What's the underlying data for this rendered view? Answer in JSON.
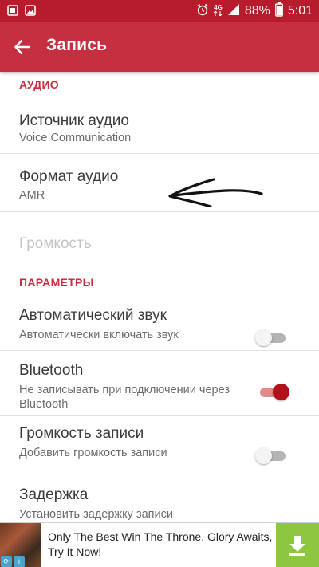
{
  "status_bar": {
    "network": "4G",
    "battery": "88%",
    "time": "5:01"
  },
  "app_bar": {
    "title": "Запись"
  },
  "sections": {
    "audio": {
      "header": "АУДИО",
      "source": {
        "title": "Источник аудио",
        "summary": "Voice Communication"
      },
      "format": {
        "title": "Формат аудио",
        "summary": "AMR"
      },
      "volume": {
        "title": "Громкость"
      }
    },
    "params": {
      "header": "ПАРАМЕТРЫ",
      "auto_sound": {
        "title": "Автоматический звук",
        "summary": "Автоматически включать звук",
        "checked": false
      },
      "bluetooth": {
        "title": "Bluetooth",
        "summary": "Не записывать при подключении через Bluetooth",
        "checked": true
      },
      "record_volume": {
        "title": "Громкость записи",
        "summary": "Добавить громкость записи",
        "checked": false
      },
      "delay": {
        "title": "Задержка",
        "summary": "Установить задержку записи"
      }
    }
  },
  "ad": {
    "text": "Only The Best Win The Throne. Glory Awaits, Try It Now!"
  },
  "colors": {
    "status_bar": "#b71c2c",
    "app_bar": "#c62f3f",
    "accent": "#c62f3f",
    "switch_on": "#b0101a",
    "ad_button": "#8dc63f"
  }
}
